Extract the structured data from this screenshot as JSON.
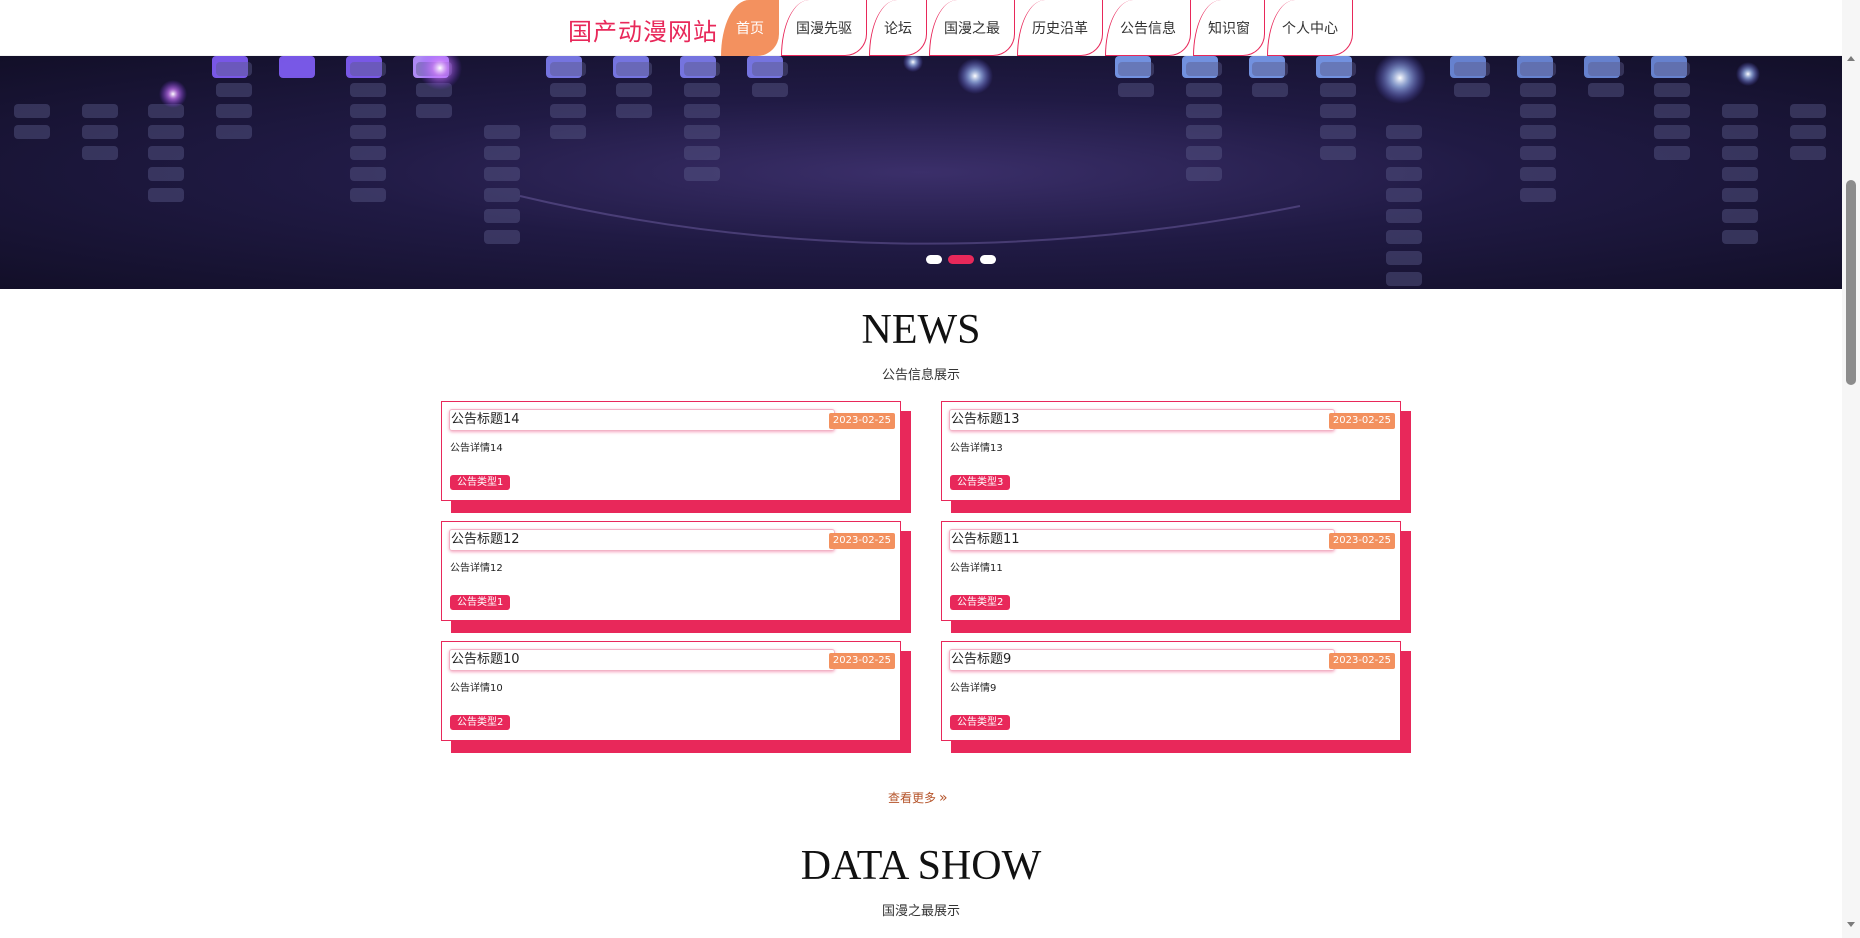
{
  "header": {
    "brand": "国产动漫网站",
    "nav": [
      {
        "label": "首页",
        "active": true
      },
      {
        "label": "国漫先驱",
        "active": false
      },
      {
        "label": "论坛",
        "active": false
      },
      {
        "label": "国漫之最",
        "active": false
      },
      {
        "label": "历史沿革",
        "active": false
      },
      {
        "label": "公告信息",
        "active": false
      },
      {
        "label": "知识窗",
        "active": false
      },
      {
        "label": "个人中心",
        "active": false
      }
    ]
  },
  "banner": {
    "slide_count": 3,
    "active_slide": 2
  },
  "news": {
    "title": "NEWS",
    "subtitle": "公告信息展示",
    "cards": [
      {
        "title": "公告标题14",
        "date": "2023-02-25",
        "detail": "公告详情14",
        "type": "公告类型1"
      },
      {
        "title": "公告标题13",
        "date": "2023-02-25",
        "detail": "公告详情13",
        "type": "公告类型3"
      },
      {
        "title": "公告标题12",
        "date": "2023-02-25",
        "detail": "公告详情12",
        "type": "公告类型1"
      },
      {
        "title": "公告标题11",
        "date": "2023-02-25",
        "detail": "公告详情11",
        "type": "公告类型2"
      },
      {
        "title": "公告标题10",
        "date": "2023-02-25",
        "detail": "公告详情10",
        "type": "公告类型2"
      },
      {
        "title": "公告标题9",
        "date": "2023-02-25",
        "detail": "公告详情9",
        "type": "公告类型2"
      }
    ],
    "more_label": "查看更多",
    "more_icon": "double-chevron-right-icon"
  },
  "data_show": {
    "title": "DATA SHOW",
    "subtitle": "国漫之最展示"
  },
  "colors": {
    "accent": "#e8285a",
    "active_tab": "#f3915f",
    "banner_bg": "#201a44"
  }
}
